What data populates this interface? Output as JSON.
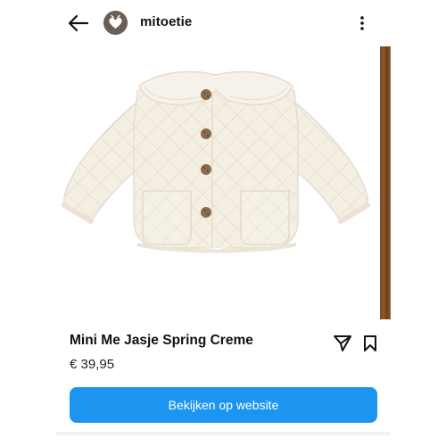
{
  "header": {
    "account_name": "mitoetie",
    "back_icon": "arrow-left-icon",
    "more_icon": "more-vertical-icon"
  },
  "product": {
    "title": "Mini Me Jasje Spring Creme",
    "price": "€ 39,95",
    "image_subject": "cream quilted baby jacket",
    "cta_label": "Bekijken op website",
    "share_icon": "paper-plane-icon",
    "save_icon": "bookmark-icon"
  },
  "colors": {
    "cta_background": "#1b95f0",
    "cta_text": "#ffffff",
    "jacket_fabric": "#f3ede1",
    "button_brown": "#8a6a4c",
    "next_image_wood": "#8b5a2b"
  }
}
